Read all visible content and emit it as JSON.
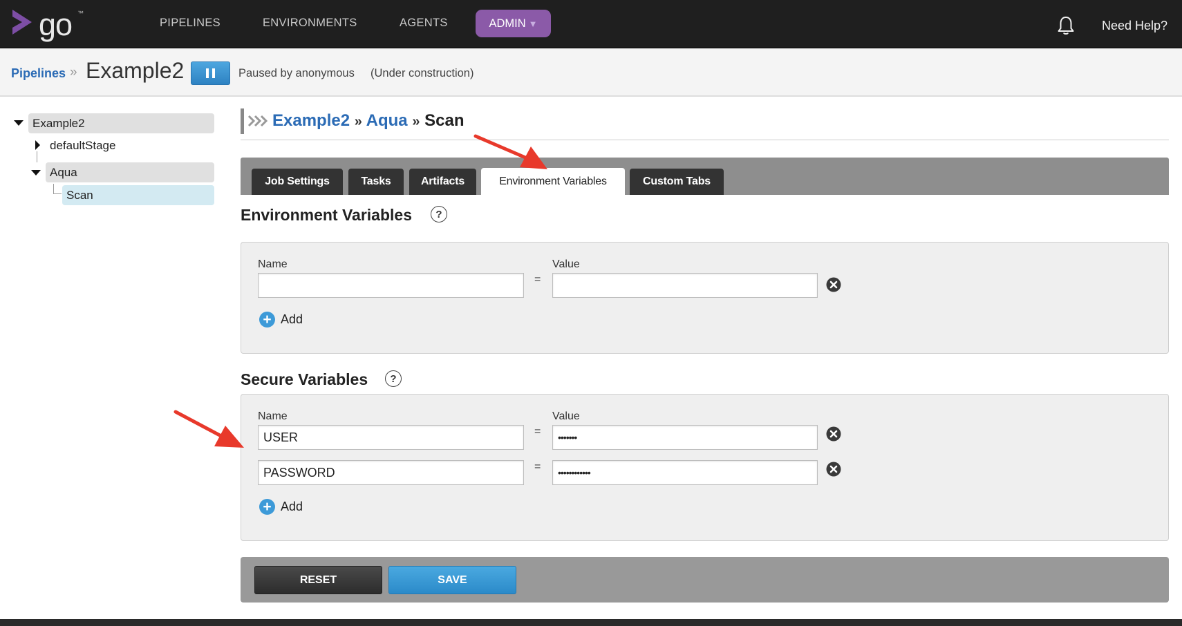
{
  "topnav": {
    "logo_text": "go",
    "logo_tm": "™",
    "items": [
      "PIPELINES",
      "ENVIRONMENTS",
      "AGENTS"
    ],
    "admin_label": "ADMIN",
    "admin_caret": "▼",
    "help_label": "Need Help?",
    "bell_icon": "bell-icon"
  },
  "breadcrumb": {
    "pipelines_link": "Pipelines",
    "separator": "»",
    "pipeline_name": "Example2",
    "paused_text": "Paused by anonymous",
    "status_text": "(Under construction)"
  },
  "tree": {
    "pipeline": "Example2",
    "stage_default": "defaultStage",
    "stage_aqua": "Aqua",
    "job": "Scan"
  },
  "page": {
    "heading_pipeline": "Example2",
    "heading_stage": "Aqua",
    "heading_job": "Scan",
    "heading_sep": "»"
  },
  "tabs": [
    {
      "label": "Job Settings",
      "active": false
    },
    {
      "label": "Tasks",
      "active": false
    },
    {
      "label": "Artifacts",
      "active": false
    },
    {
      "label": "Environment Variables",
      "active": true
    },
    {
      "label": "Custom Tabs",
      "active": false
    }
  ],
  "env_vars": {
    "title": "Environment Variables",
    "help": "?",
    "name_label": "Name",
    "value_label": "Value",
    "equals": "=",
    "rows": [
      {
        "name": "",
        "value": ""
      }
    ],
    "add_label": "Add"
  },
  "secure_vars": {
    "title": "Secure Variables",
    "help": "?",
    "name_label": "Name",
    "value_label": "Value",
    "equals": "=",
    "rows": [
      {
        "name": "USER",
        "value": "•••••••"
      },
      {
        "name": "PASSWORD",
        "value": "••••••••••••"
      }
    ],
    "add_label": "Add"
  },
  "actions": {
    "reset_label": "RESET",
    "save_label": "SAVE"
  },
  "colors": {
    "topbar": "#1f1f1f",
    "admin": "#8b5aa8",
    "link": "#2b6bb5",
    "primary_button": "#2e82c2",
    "annotation_arrow": "#e8392b"
  }
}
